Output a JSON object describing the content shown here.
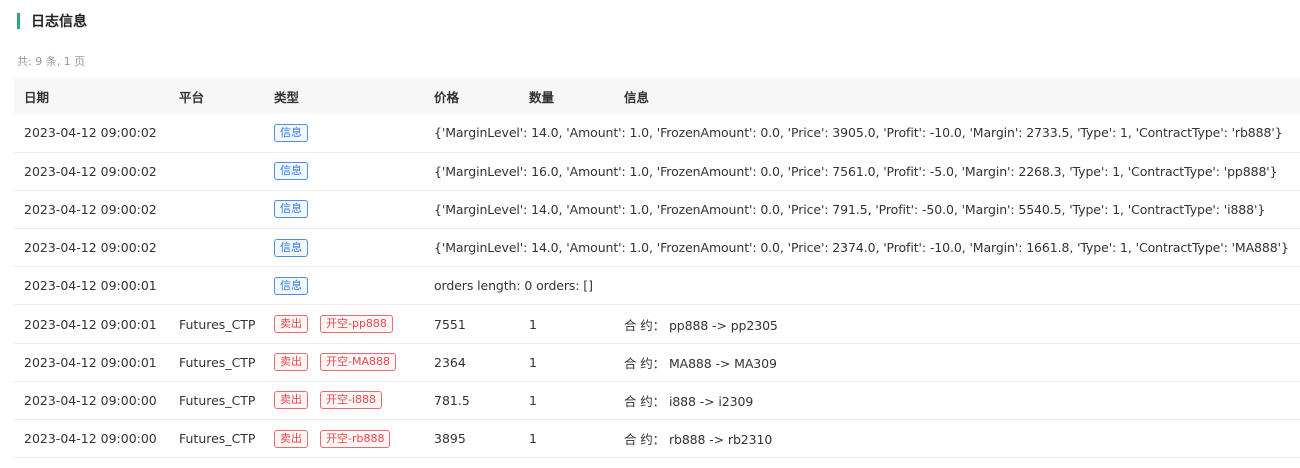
{
  "header": {
    "title": "日志信息"
  },
  "summary": "共: 9 条, 1 页",
  "colors": {
    "accent": "#2aa876",
    "info_tag": "#2f7bdc",
    "sell_tag": "#e5484d"
  },
  "columns": [
    "日期",
    "平台",
    "类型",
    "",
    "价格",
    "数量",
    "信息"
  ],
  "rows": [
    {
      "date": "2023-04-12 09:00:02",
      "platform": "",
      "tags": [
        {
          "label": "信息",
          "color": "blue"
        }
      ],
      "price": "",
      "qty": "",
      "info": "{'MarginLevel': 14.0, 'Amount': 1.0, 'FrozenAmount': 0.0, 'Price': 3905.0, 'Profit': -10.0, 'Margin': 2733.5, 'Type': 1, 'ContractType': 'rb888'}"
    },
    {
      "date": "2023-04-12 09:00:02",
      "platform": "",
      "tags": [
        {
          "label": "信息",
          "color": "blue"
        }
      ],
      "price": "",
      "qty": "",
      "info": "{'MarginLevel': 16.0, 'Amount': 1.0, 'FrozenAmount': 0.0, 'Price': 7561.0, 'Profit': -5.0, 'Margin': 2268.3, 'Type': 1, 'ContractType': 'pp888'}"
    },
    {
      "date": "2023-04-12 09:00:02",
      "platform": "",
      "tags": [
        {
          "label": "信息",
          "color": "blue"
        }
      ],
      "price": "",
      "qty": "",
      "info": "{'MarginLevel': 14.0, 'Amount': 1.0, 'FrozenAmount': 0.0, 'Price': 791.5, 'Profit': -50.0, 'Margin': 5540.5, 'Type': 1, 'ContractType': 'i888'}"
    },
    {
      "date": "2023-04-12 09:00:02",
      "platform": "",
      "tags": [
        {
          "label": "信息",
          "color": "blue"
        }
      ],
      "price": "",
      "qty": "",
      "info": "{'MarginLevel': 14.0, 'Amount': 1.0, 'FrozenAmount': 0.0, 'Price': 2374.0, 'Profit': -10.0, 'Margin': 1661.8, 'Type': 1, 'ContractType': 'MA888'}"
    },
    {
      "date": "2023-04-12 09:00:01",
      "platform": "",
      "tags": [
        {
          "label": "信息",
          "color": "blue"
        }
      ],
      "price": "",
      "qty": "",
      "info": "orders length: 0 orders: []"
    },
    {
      "date": "2023-04-12 09:00:01",
      "platform": "Futures_CTP",
      "tags": [
        {
          "label": "卖出",
          "color": "red"
        },
        {
          "label": "开空-pp888",
          "color": "red"
        }
      ],
      "price": "7551",
      "qty": "1",
      "info": "合 约： pp888 -> pp2305"
    },
    {
      "date": "2023-04-12 09:00:01",
      "platform": "Futures_CTP",
      "tags": [
        {
          "label": "卖出",
          "color": "red"
        },
        {
          "label": "开空-MA888",
          "color": "red"
        }
      ],
      "price": "2364",
      "qty": "1",
      "info": "合 约： MA888 -> MA309"
    },
    {
      "date": "2023-04-12 09:00:00",
      "platform": "Futures_CTP",
      "tags": [
        {
          "label": "卖出",
          "color": "red"
        },
        {
          "label": "开空-i888",
          "color": "red"
        }
      ],
      "price": "781.5",
      "qty": "1",
      "info": "合 约： i888 -> i2309"
    },
    {
      "date": "2023-04-12 09:00:00",
      "platform": "Futures_CTP",
      "tags": [
        {
          "label": "卖出",
          "color": "red"
        },
        {
          "label": "开空-rb888",
          "color": "red"
        }
      ],
      "price": "3895",
      "qty": "1",
      "info": "合 约： rb888 -> rb2310"
    }
  ]
}
